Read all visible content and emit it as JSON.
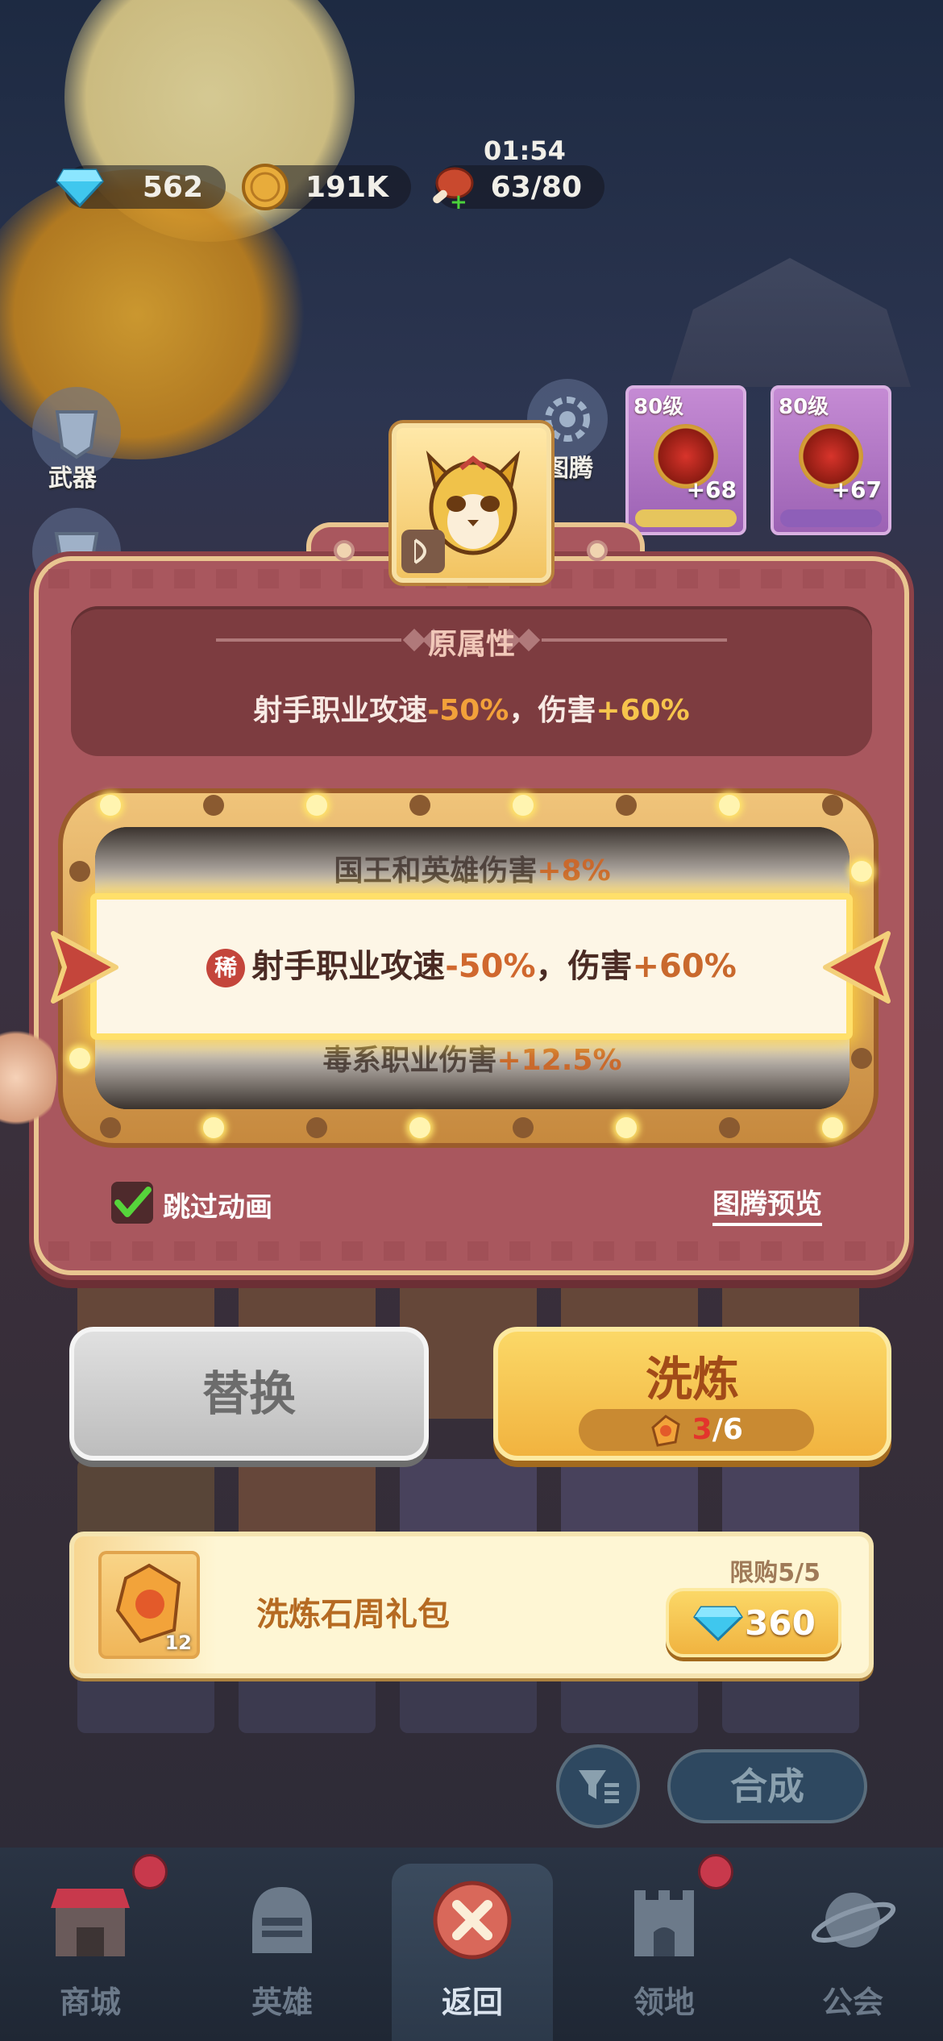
{
  "resources": {
    "gems": "562",
    "gold": "191K",
    "stamina": "63/80",
    "timer": "01:54"
  },
  "side": {
    "weapon_label": "武器",
    "totem_label": "图腾"
  },
  "equip_cards": [
    {
      "level": "80级",
      "bonus": "+68"
    },
    {
      "level": "80级",
      "bonus": "+67"
    }
  ],
  "original": {
    "title": "原属性",
    "prefix": "射手职业攻速",
    "neg": "-50%",
    "mid": "，伤害",
    "pos": "+60%"
  },
  "reel": {
    "top": {
      "prefix": "国王和英雄伤害",
      "value": "+8%"
    },
    "mid": {
      "badge": "稀",
      "prefix": "射手职业攻速",
      "neg": "-50%",
      "mid": "，伤害",
      "pos": "+60%"
    },
    "bottom": {
      "prefix": "毒系职业伤害",
      "value": "+12.5%"
    }
  },
  "options": {
    "skip_label": "跳过动画",
    "skip_checked": true,
    "preview_label": "图腾预览"
  },
  "buttons": {
    "replace": "替换",
    "wash": "洗炼",
    "wash_cost_used": "3",
    "wash_cost_total": "/6"
  },
  "pack": {
    "name": "洗炼石周礼包",
    "limit": "限购5/5",
    "price": "360",
    "count": "12"
  },
  "lower": {
    "combine": "合成"
  },
  "nav": {
    "items": [
      {
        "label": "商城",
        "icon": "shop-icon",
        "badge": true
      },
      {
        "label": "英雄",
        "icon": "helmet-icon",
        "badge": false
      },
      {
        "label": "返回",
        "icon": "close-icon",
        "badge": false,
        "active": true
      },
      {
        "label": "领地",
        "icon": "castle-icon",
        "badge": true
      },
      {
        "label": "公会",
        "icon": "planet-icon",
        "badge": false
      }
    ]
  },
  "colors": {
    "panel": "#a9575e",
    "accent_gold": "#f6c44c",
    "negative": "#f2a13a"
  }
}
